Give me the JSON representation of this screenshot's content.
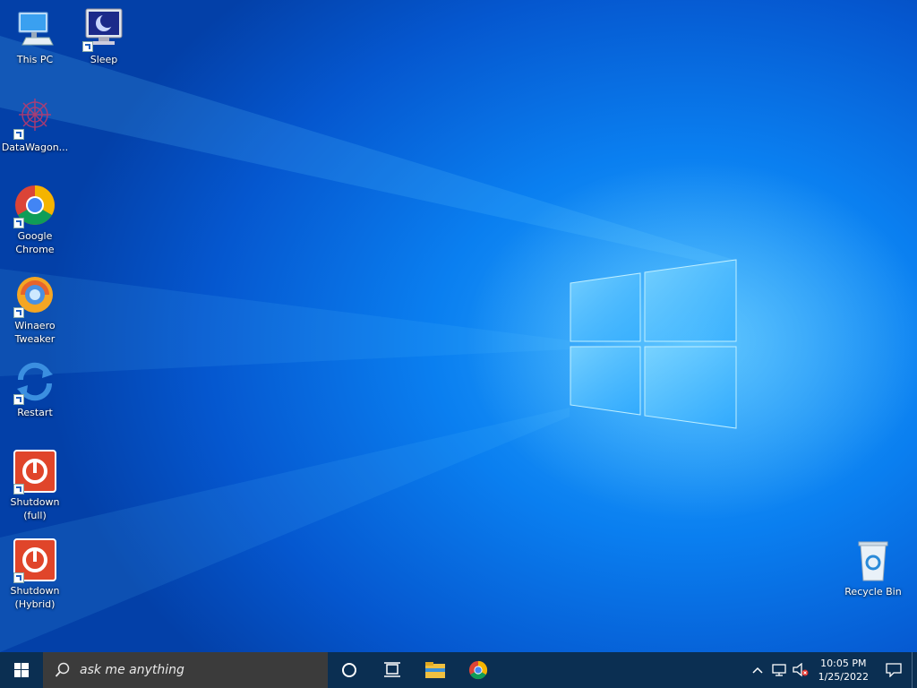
{
  "desktop": {
    "icons": [
      {
        "label": "This PC",
        "icon": "this-pc-icon"
      },
      {
        "label": "Sleep",
        "icon": "sleep-icon"
      },
      {
        "label": "DataWagon...",
        "icon": "datawagon-icon"
      },
      {
        "label": "Google\nChrome",
        "icon": "chrome-icon"
      },
      {
        "label": "Winaero\nTweaker",
        "icon": "winaero-tweaker-icon"
      },
      {
        "label": "Restart",
        "icon": "restart-icon"
      },
      {
        "label": "Shutdown\n(full)",
        "icon": "shutdown-icon"
      },
      {
        "label": "Shutdown\n(Hybrid)",
        "icon": "shutdown-icon"
      },
      {
        "label": "Recycle Bin",
        "icon": "recycle-bin-icon"
      }
    ]
  },
  "taskbar": {
    "search_placeholder": "ask me anything",
    "clock_time": "10:05 PM",
    "clock_date": "1/25/2022"
  },
  "colors": {
    "taskbar": "#0b2f52",
    "wallpaper_accent": "#0a7ff0",
    "shutdown_red": "#e0452a"
  }
}
